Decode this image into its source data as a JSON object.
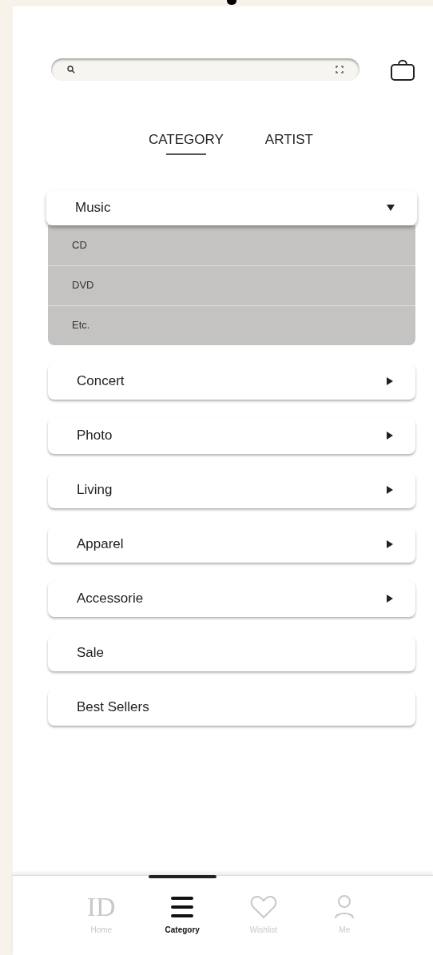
{
  "tabs": [
    {
      "label": "CATEGORY",
      "selected": true
    },
    {
      "label": "ARTIST",
      "selected": false
    }
  ],
  "categories": [
    {
      "label": "Music",
      "kind": "dropdown",
      "expanded": true,
      "children": [
        {
          "label": "CD"
        },
        {
          "label": "DVD"
        },
        {
          "label": "Etc."
        }
      ]
    },
    {
      "label": "Concert",
      "kind": "submenu"
    },
    {
      "label": "Photo",
      "kind": "submenu"
    },
    {
      "label": "Living",
      "kind": "submenu"
    },
    {
      "label": "Apparel",
      "kind": "submenu"
    },
    {
      "label": "Accessorie",
      "kind": "submenu"
    },
    {
      "label": "Sale",
      "kind": "link"
    },
    {
      "label": "Best Sellers",
      "kind": "link"
    }
  ],
  "bottom_nav": [
    {
      "label": "Home",
      "kind": "logo",
      "logo_text": "ID",
      "selected": false
    },
    {
      "label": "Category",
      "kind": "menu",
      "selected": true
    },
    {
      "label": "Wishlist",
      "kind": "heart",
      "selected": false
    },
    {
      "label": "Me",
      "kind": "person",
      "selected": false
    }
  ]
}
